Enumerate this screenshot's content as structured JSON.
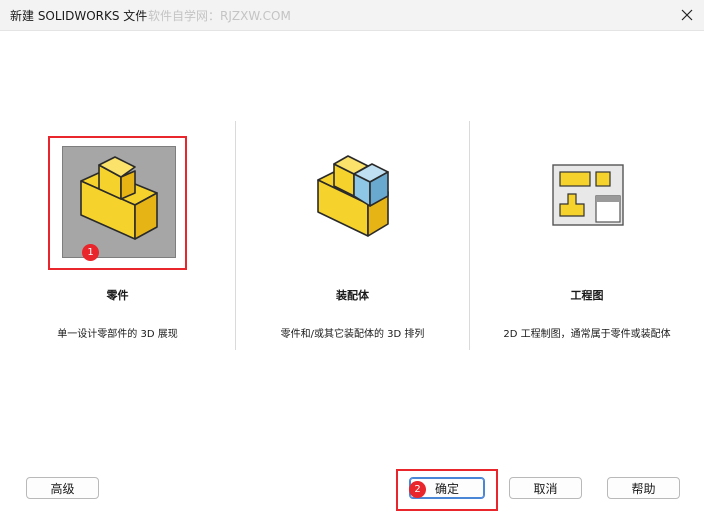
{
  "window": {
    "title": "新建 SOLIDWORKS 文件",
    "watermark": "软件自学网：RJZXW.COM"
  },
  "options": [
    {
      "label": "零件",
      "description": "单一设计零部件的 3D 展现",
      "badge": "1"
    },
    {
      "label": "装配体",
      "description": "零件和/或其它装配体的 3D 排列"
    },
    {
      "label": "工程图",
      "description": "2D 工程制图，通常属于零件或装配体"
    }
  ],
  "buttons": {
    "advanced": "高级",
    "ok": "确定",
    "ok_badge": "2",
    "cancel": "取消",
    "help": "帮助"
  },
  "colors": {
    "highlight": "#e8262b",
    "part_yellow": "#f6d32c",
    "assembly_blue": "#8ec7e6",
    "focus_blue": "#4a86d6"
  }
}
